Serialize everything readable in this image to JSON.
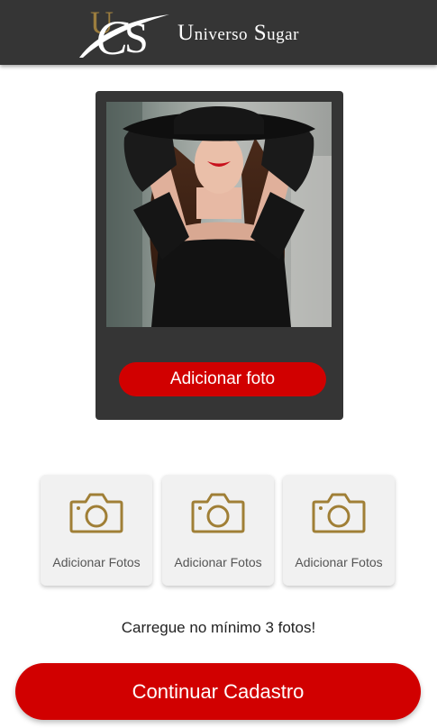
{
  "header": {
    "logo_monogram": "US",
    "brand_name": "Universo Sugar",
    "brand_first_initial": "U",
    "brand_first_rest": "niverso",
    "brand_second_initial": "S",
    "brand_second_rest": "ugar",
    "colors": {
      "background": "#353535",
      "gold": "#9b7d3e",
      "text": "#ffffff"
    }
  },
  "main_photo_card": {
    "photo_icon": "profile-photo-woman-black-hat",
    "add_photo_label": "Adicionar foto"
  },
  "photo_slots": [
    {
      "icon": "camera-icon",
      "label": "Adicionar Fotos"
    },
    {
      "icon": "camera-icon",
      "label": "Adicionar Fotos"
    },
    {
      "icon": "camera-icon",
      "label": "Adicionar Fotos"
    }
  ],
  "hint_text": "Carregue no mínimo 3 fotos!",
  "continue_label": "Continuar Cadastro",
  "colors": {
    "accent": "#d10000",
    "camera_gold": "#a07f36",
    "tile_bg": "#f1f1f1"
  }
}
